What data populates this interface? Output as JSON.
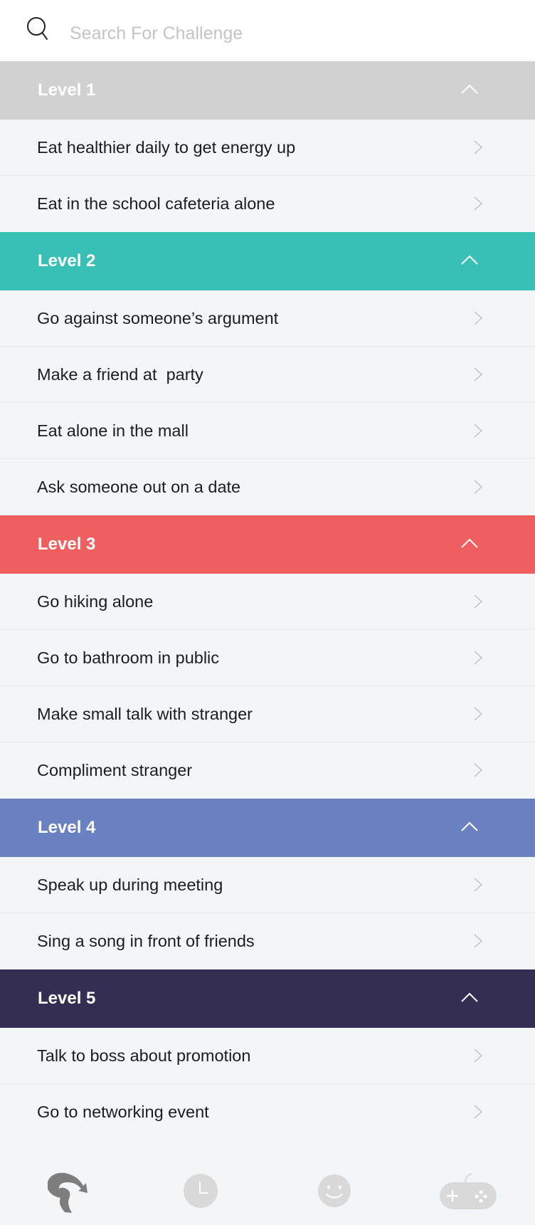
{
  "search": {
    "placeholder": "Search For Challenge",
    "value": ""
  },
  "colors": {
    "level_1": "#d1d1d1",
    "level_2": "#39c0b6",
    "level_3": "#ef5f5f",
    "level_4": "#6a82c1",
    "level_5": "#332e52",
    "icon_inactive": "#d9d9d9",
    "icon_active": "#7d7d7d"
  },
  "levels": [
    {
      "title": "Level 1",
      "items": [
        "Eat healthier daily to get energy up",
        "Eat in the school cafeteria alone"
      ]
    },
    {
      "title": "Level 2",
      "items": [
        "Go against someone’s argument",
        "Make a friend at  party",
        "Eat alone in the mall",
        "Ask someone out on a date"
      ]
    },
    {
      "title": "Level 3",
      "items": [
        "Go hiking alone",
        "Go to bathroom in public",
        "Make small talk with stranger",
        "Compliment stranger"
      ]
    },
    {
      "title": "Level 4",
      "items": [
        "Speak up during meeting",
        "Sing a song in front of friends"
      ]
    },
    {
      "title": "Level 5",
      "items": [
        "Talk to boss about promotion",
        "Go to networking event"
      ]
    }
  ],
  "tabs": [
    {
      "icon": "challenge-path-icon",
      "active": true
    },
    {
      "icon": "clock-icon",
      "active": false
    },
    {
      "icon": "smiley-icon",
      "active": false
    },
    {
      "icon": "gamepad-icon",
      "active": false
    }
  ]
}
